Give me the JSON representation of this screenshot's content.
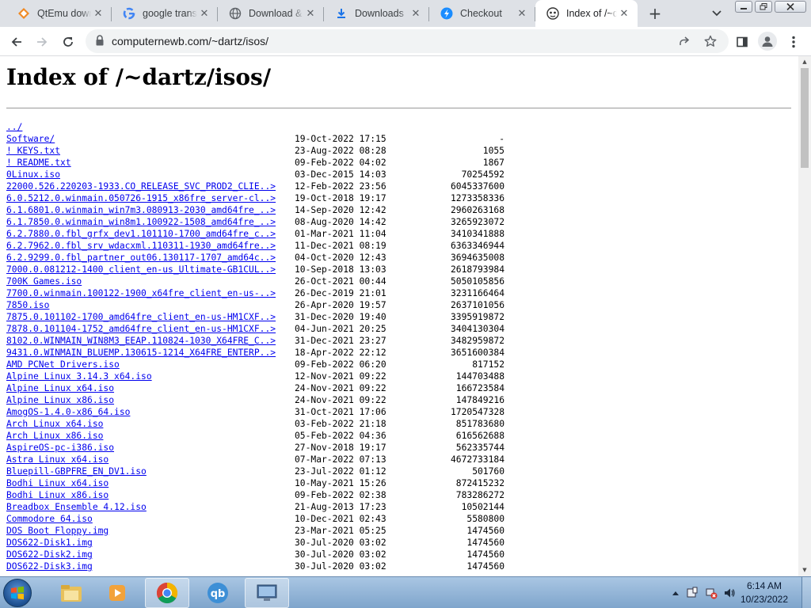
{
  "tabs": [
    {
      "title": "QtEmu download",
      "icon": "qtemu-icon"
    },
    {
      "title": "google translate",
      "icon": "google-icon"
    },
    {
      "title": "Download & Install",
      "icon": "globe-icon"
    },
    {
      "title": "Downloads",
      "icon": "download-icon"
    },
    {
      "title": "Checkout",
      "icon": "checkout-icon"
    },
    {
      "title": "Index of /~dartz/isos/",
      "icon": "site-icon",
      "active": true
    }
  ],
  "address": {
    "url": "computernewb.com/~dartz/isos/"
  },
  "page": {
    "title": "Index of /~dartz/isos/",
    "parent_link": "../",
    "entries": [
      [
        "Software/",
        "19-Oct-2022 17:15",
        "-"
      ],
      [
        "! KEYS.txt",
        "23-Aug-2022 08:28",
        "1055"
      ],
      [
        "! README.txt",
        "09-Feb-2022 04:02",
        "1867"
      ],
      [
        "0Linux.iso",
        "03-Dec-2015 14:03",
        "70254592"
      ],
      [
        "22000.526.220203-1933.CO_RELEASE_SVC_PROD2_CLIE..>",
        "12-Feb-2022 23:56",
        "6045337600"
      ],
      [
        "6.0.5212.0.winmain.050726-1915_x86fre_server-cl..>",
        "19-Oct-2018 19:17",
        "1273358336"
      ],
      [
        "6.1.6801.0.winmain_win7m3.080913-2030_amd64fre_..>",
        "14-Sep-2020 12:42",
        "2960263168"
      ],
      [
        "6.1.7850.0.winmain_win8m1.100922-1508_amd64fre_..>",
        "08-Aug-2020 14:42",
        "3265923072"
      ],
      [
        "6.2.7880.0.fbl_grfx_dev1.101110-1700_amd64fre_c..>",
        "01-Mar-2021 11:04",
        "3410341888"
      ],
      [
        "6.2.7962.0.fbl_srv_wdacxml.110311-1930_amd64fre..>",
        "11-Dec-2021 08:19",
        "6363346944"
      ],
      [
        "6.2.9299.0.fbl_partner_out06.130117-1707_amd64c..>",
        "04-Oct-2020 12:43",
        "3694635008"
      ],
      [
        "7000.0.081212-1400_client_en-us_Ultimate-GB1CUL..>",
        "10-Sep-2018 13:03",
        "2618793984"
      ],
      [
        "700K Games.iso",
        "26-Oct-2021 00:44",
        "5050105856"
      ],
      [
        "7700.0.winmain.100122-1900_x64fre_client_en-us-..>",
        "26-Dec-2019 21:01",
        "3231166464"
      ],
      [
        "7850.iso",
        "26-Apr-2020 19:57",
        "2637101056"
      ],
      [
        "7875.0.101102-1700_amd64fre_client_en-us-HM1CXF..>",
        "31-Dec-2020 19:40",
        "3395919872"
      ],
      [
        "7878.0.101104-1752_amd64fre_client_en-us-HM1CXF..>",
        "04-Jun-2021 20:25",
        "3404130304"
      ],
      [
        "8102.0.WINMAIN_WIN8M3_EEAP.110824-1030_X64FRE_C..>",
        "31-Dec-2021 23:27",
        "3482959872"
      ],
      [
        "9431.0.WINMAIN_BLUEMP.130615-1214_X64FRE_ENTERP..>",
        "18-Apr-2022 22:12",
        "3651600384"
      ],
      [
        "AMD PCNet Drivers.iso",
        "09-Feb-2022 06:20",
        "817152"
      ],
      [
        "Alpine Linux 3.14.3 x64.iso",
        "12-Nov-2021 09:22",
        "144703488"
      ],
      [
        "Alpine Linux x64.iso",
        "24-Nov-2021 09:22",
        "166723584"
      ],
      [
        "Alpine Linux x86.iso",
        "24-Nov-2021 09:22",
        "147849216"
      ],
      [
        "AmogOS-1.4.0-x86_64.iso",
        "31-Oct-2021 17:06",
        "1720547328"
      ],
      [
        "Arch Linux x64.iso",
        "03-Feb-2022 21:18",
        "851783680"
      ],
      [
        "Arch Linux x86.iso",
        "05-Feb-2022 04:36",
        "616562688"
      ],
      [
        "AspireOS-pc-i386.iso",
        "27-Nov-2018 19:17",
        "562335744"
      ],
      [
        "Astra Linux x64.iso",
        "07-Mar-2022 07:13",
        "4672733184"
      ],
      [
        "Bluepill-GBPFRE_EN_DV1.iso",
        "23-Jul-2022 01:12",
        "501760"
      ],
      [
        "Bodhi Linux x64.iso",
        "10-May-2021 15:26",
        "872415232"
      ],
      [
        "Bodhi Linux x86.iso",
        "09-Feb-2022 02:38",
        "783286272"
      ],
      [
        "Breadbox Ensemble 4.12.iso",
        "21-Aug-2013 17:23",
        "10502144"
      ],
      [
        "Commodore 64.iso",
        "10-Dec-2021 02:43",
        "5580800"
      ],
      [
        "DOS Boot Floppy.img",
        "23-Mar-2021 05:25",
        "1474560"
      ],
      [
        "DOS622-Disk1.img",
        "30-Jul-2020 03:02",
        "1474560"
      ],
      [
        "DOS622-Disk2.img",
        "30-Jul-2020 03:02",
        "1474560"
      ],
      [
        "DOS622-Disk3.img",
        "30-Jul-2020 03:02",
        "1474560"
      ]
    ]
  },
  "taskbar": {
    "time": "6:14 AM",
    "date": "10/23/2022"
  },
  "colors": {
    "link": "#0000ee",
    "tabstrip": "#dee1e6",
    "omnibox": "#f1f3f4"
  }
}
